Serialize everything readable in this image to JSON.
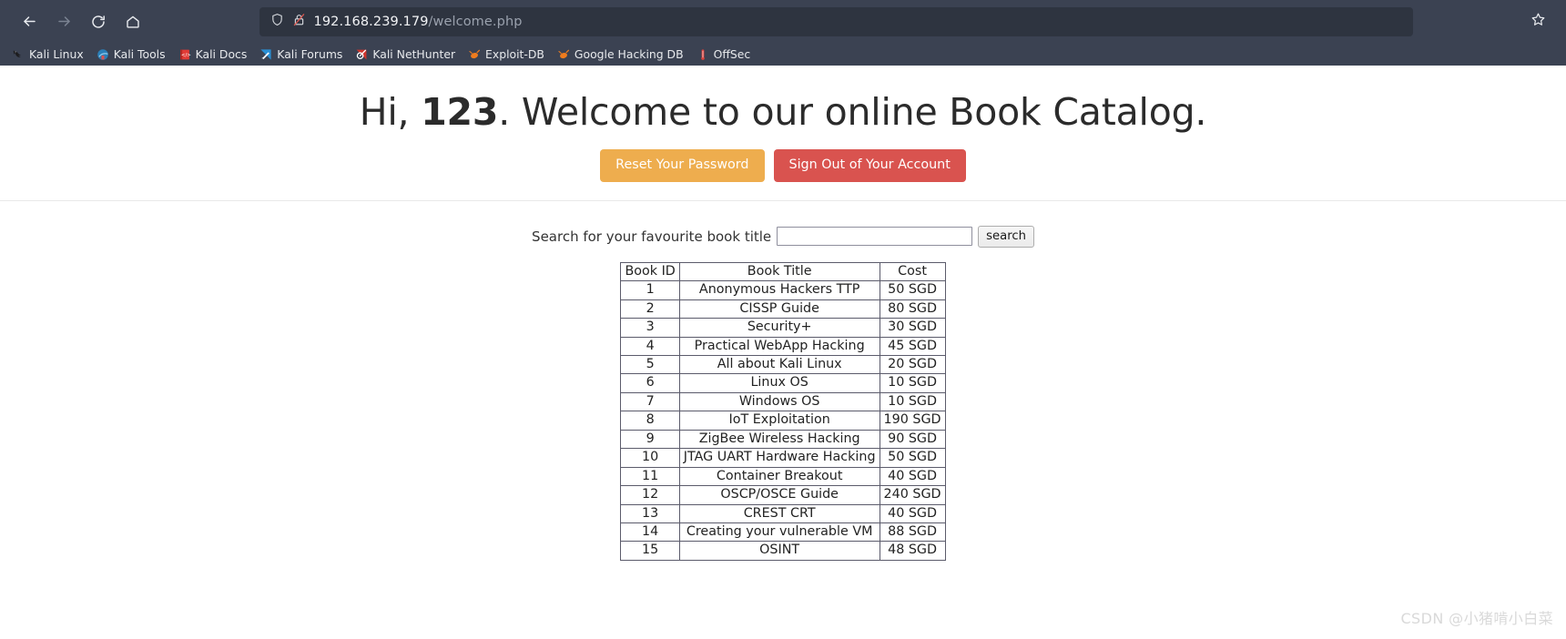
{
  "browser": {
    "nav": {
      "back_icon": "arrow-left-icon",
      "forward_icon": "arrow-right-icon",
      "reload_icon": "reload-icon",
      "home_icon": "home-icon"
    },
    "urlbar": {
      "shield_icon": "shield-icon",
      "lock_icon": "lock-crossed-icon",
      "host": "192.168.239.179",
      "path": "/welcome.php",
      "bookmark_star_icon": "star-icon"
    },
    "bookmarks": [
      {
        "label": "Kali Linux",
        "icon": "kali-dragon-icon"
      },
      {
        "label": "Kali Tools",
        "icon": "kali-tools-icon"
      },
      {
        "label": "Kali Docs",
        "icon": "kali-docs-icon"
      },
      {
        "label": "Kali Forums",
        "icon": "kali-forums-icon"
      },
      {
        "label": "Kali NetHunter",
        "icon": "kali-nethunter-icon"
      },
      {
        "label": "Exploit-DB",
        "icon": "exploit-db-icon"
      },
      {
        "label": "Google Hacking DB",
        "icon": "google-hacking-db-icon"
      },
      {
        "label": "OffSec",
        "icon": "offsec-icon"
      }
    ]
  },
  "page": {
    "heading_prefix": "Hi, ",
    "heading_user": "123",
    "heading_suffix": ". Welcome to our online Book Catalog.",
    "reset_password_label": "Reset Your Password",
    "sign_out_label": "Sign Out of Your Account",
    "search_label": "Search for your favourite book title",
    "search_value": "",
    "search_placeholder": "",
    "search_button_label": "search",
    "table": {
      "headers": [
        "Book ID",
        "Book Title",
        "Cost"
      ],
      "rows": [
        [
          "1",
          "Anonymous Hackers TTP",
          "50 SGD"
        ],
        [
          "2",
          "CISSP Guide",
          "80 SGD"
        ],
        [
          "3",
          "Security+",
          "30 SGD"
        ],
        [
          "4",
          "Practical WebApp Hacking",
          "45 SGD"
        ],
        [
          "5",
          "All about Kali Linux",
          "20 SGD"
        ],
        [
          "6",
          "Linux OS",
          "10 SGD"
        ],
        [
          "7",
          "Windows OS",
          "10 SGD"
        ],
        [
          "8",
          "IoT Exploitation",
          "190 SGD"
        ],
        [
          "9",
          "ZigBee Wireless Hacking",
          "90 SGD"
        ],
        [
          "10",
          "JTAG UART Hardware Hacking",
          "50 SGD"
        ],
        [
          "11",
          "Container Breakout",
          "40 SGD"
        ],
        [
          "12",
          "OSCP/OSCE Guide",
          "240 SGD"
        ],
        [
          "13",
          "CREST CRT",
          "40 SGD"
        ],
        [
          "14",
          "Creating your vulnerable VM",
          "88 SGD"
        ],
        [
          "15",
          "OSINT",
          "48 SGD"
        ]
      ]
    },
    "watermark": "CSDN @小猪啃小白菜"
  },
  "colors": {
    "chrome_bg": "#3b4252",
    "urlbar_bg": "#2e3440",
    "warning": "#eead4e",
    "danger": "#d9534f",
    "table_border": "#5b5b6b"
  }
}
